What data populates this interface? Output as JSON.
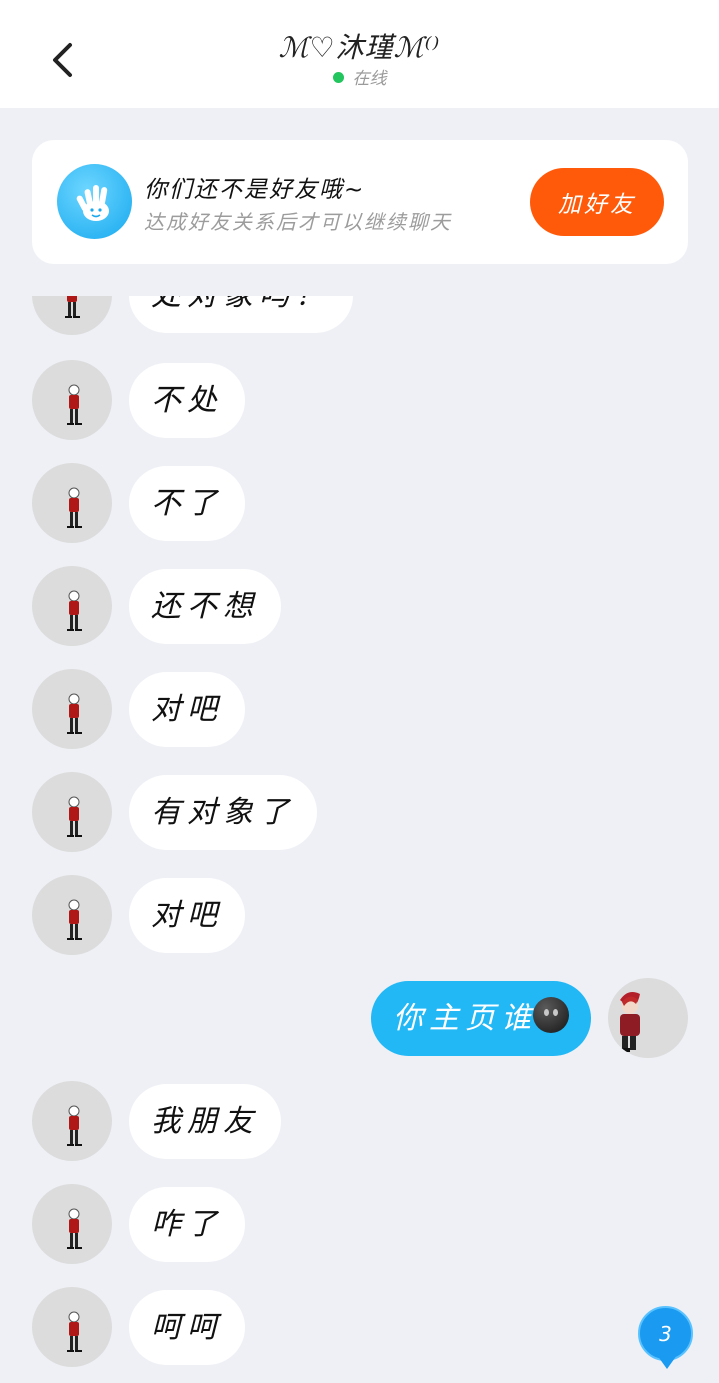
{
  "header": {
    "title": "ℳ♡沐瑾ℳ⁽⁾",
    "status": "在线",
    "status_color": "#22c55e"
  },
  "notice": {
    "title": "你们还不是好友哦~",
    "subtitle": "达成好友关系后才可以继续聊天",
    "add_button": "加好友",
    "icon": "hand-wave-icon",
    "accent": "#ff5a0a"
  },
  "messages": [
    {
      "side": "left",
      "text": "处对象吗？"
    },
    {
      "side": "left",
      "text": "不处"
    },
    {
      "side": "left",
      "text": "不了"
    },
    {
      "side": "left",
      "text": "还不想"
    },
    {
      "side": "left",
      "text": "对吧"
    },
    {
      "side": "left",
      "text": "有对象了"
    },
    {
      "side": "left",
      "text": "对吧"
    },
    {
      "side": "right",
      "text": "你主页谁",
      "emoji": "dark-smile-emoji"
    },
    {
      "side": "left",
      "text": "我朋友"
    },
    {
      "side": "left",
      "text": "咋了"
    },
    {
      "side": "left",
      "text": "呵呵"
    }
  ],
  "float_badge": {
    "label": "3",
    "color": "#1a9af0"
  },
  "bubble_colors": {
    "incoming": "#ffffff",
    "outgoing": "#22b7f5"
  }
}
